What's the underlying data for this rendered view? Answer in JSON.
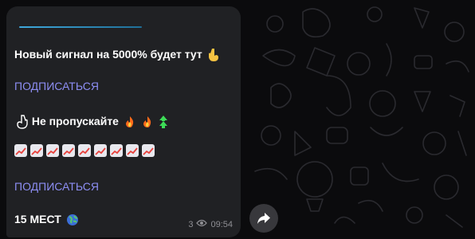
{
  "message": {
    "line1": "Новый сигнал на 5000% будет тут",
    "link1": "ПОДПИСАТЬСЯ",
    "line3": "Не пропускайте",
    "link2": "ПОДПИСАТЬСЯ",
    "line6": "15 МЕСТ",
    "views": "3",
    "time": "09:54"
  },
  "icons": {
    "line1_end": "hand-pointing-down-icon",
    "line3_start": "hand-pointing-up-icon",
    "line3_end": [
      "fire-icon",
      "fire-icon",
      "double-up-arrow-icon"
    ],
    "line4": [
      "chart-increasing-icon",
      "chart-increasing-icon",
      "chart-increasing-icon",
      "chart-increasing-icon",
      "chart-increasing-icon",
      "chart-increasing-icon",
      "chart-increasing-icon",
      "chart-increasing-icon",
      "chart-increasing-icon"
    ],
    "line6_end": "globe-icon",
    "views": "eye-icon",
    "share": "share-arrow-icon"
  },
  "colors": {
    "link": "#8d8ef4",
    "bubble": "#202124",
    "background": "#0b0b0d"
  }
}
